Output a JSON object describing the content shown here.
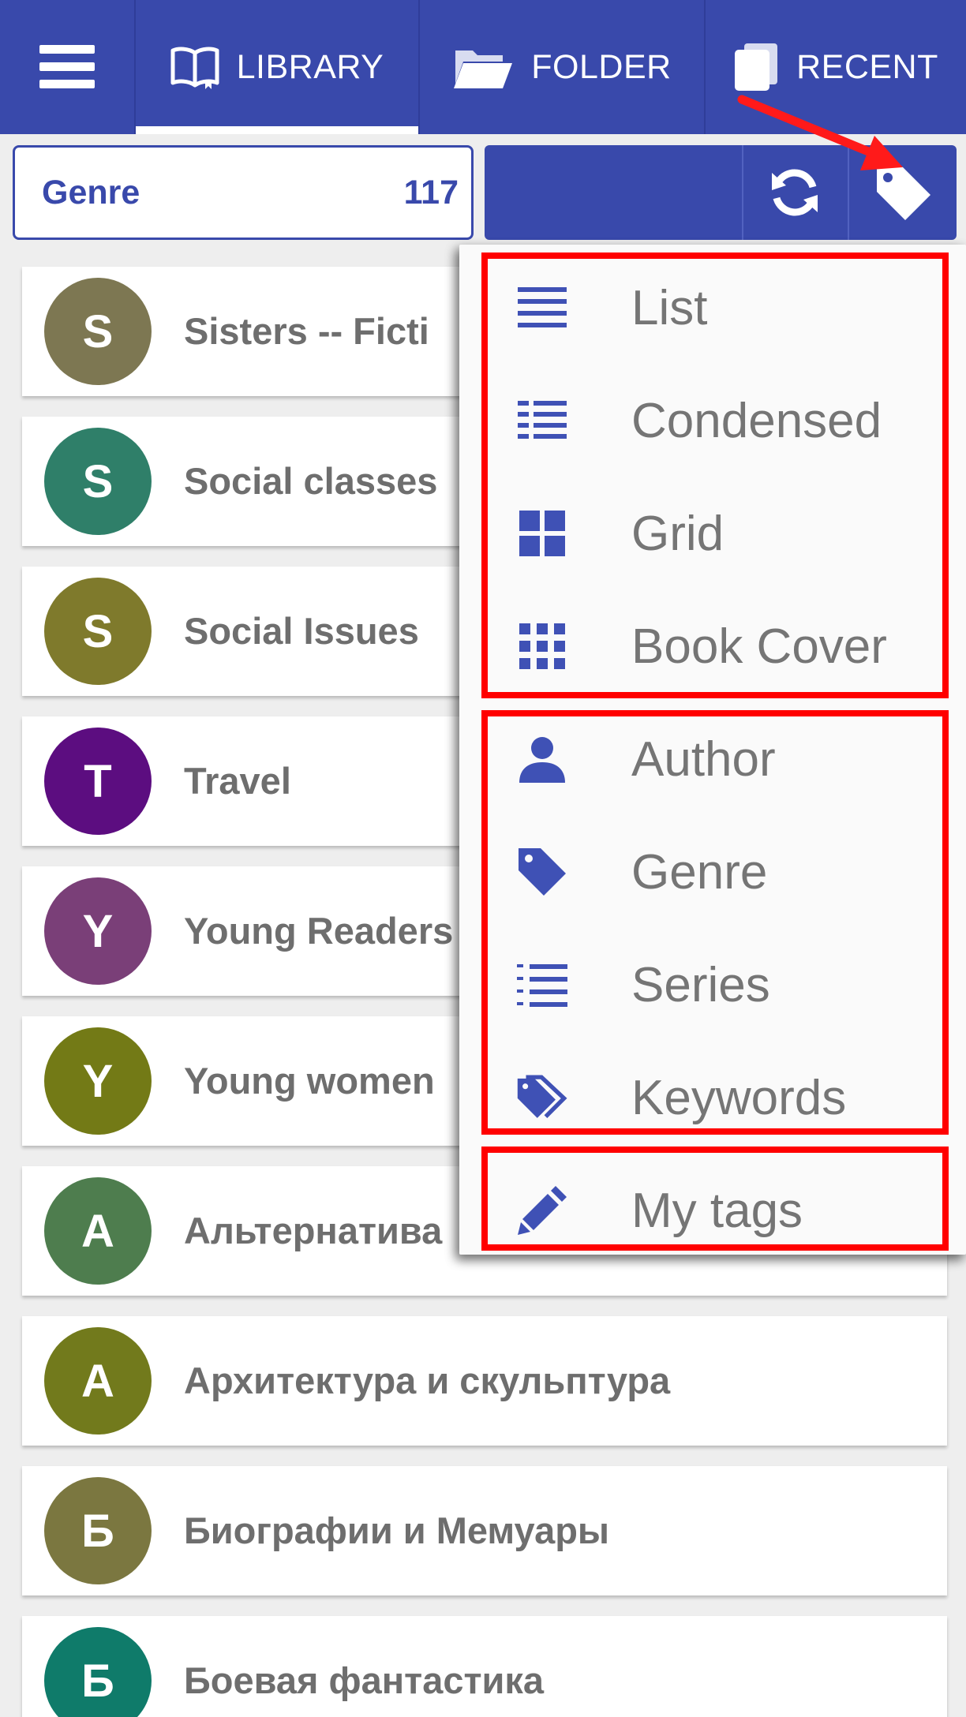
{
  "tabs": [
    {
      "label": "LIBRARY",
      "icon": "book-icon",
      "selected": true
    },
    {
      "label": "FOLDER",
      "icon": "folder-icon",
      "selected": false
    },
    {
      "label": "RECENT",
      "icon": "recent-books-icon",
      "selected": false
    }
  ],
  "filter": {
    "label": "Genre",
    "count": "117"
  },
  "list": [
    {
      "initial": "S",
      "label": "Sisters -- Ficti",
      "color": "#7d7752"
    },
    {
      "initial": "S",
      "label": "Social classes",
      "color": "#2f7f69"
    },
    {
      "initial": "S",
      "label": "Social Issues",
      "color": "#7f7a2c"
    },
    {
      "initial": "T",
      "label": "Travel",
      "color": "#5c0d80"
    },
    {
      "initial": "Y",
      "label": "Young Readers",
      "color": "#7a3f78"
    },
    {
      "initial": "Y",
      "label": "Young women",
      "color": "#737a16"
    },
    {
      "initial": "A",
      "label": "Альтернатива",
      "color": "#4e7d4e"
    },
    {
      "initial": "A",
      "label": "Архитектура и скульптура",
      "color": "#727a1c"
    },
    {
      "initial": "Б",
      "label": "Биографии и Мемуары",
      "color": "#7b7740"
    },
    {
      "initial": "Б",
      "label": "Боевая фантастика",
      "color": "#0f7b6a"
    }
  ],
  "menu": {
    "views": [
      {
        "label": "List",
        "icon": "list-icon"
      },
      {
        "label": "Condensed",
        "icon": "condensed-list-icon"
      },
      {
        "label": "Grid",
        "icon": "grid-icon"
      },
      {
        "label": "Book Cover",
        "icon": "book-cover-grid-icon"
      }
    ],
    "groups": [
      {
        "label": "Author",
        "icon": "person-icon"
      },
      {
        "label": "Genre",
        "icon": "tag-icon"
      },
      {
        "label": "Series",
        "icon": "numbered-list-icon"
      },
      {
        "label": "Keywords",
        "icon": "tags-icon"
      }
    ],
    "extra": [
      {
        "label": "My tags",
        "icon": "pencil-icon"
      }
    ]
  },
  "colors": {
    "primary": "#3949ab",
    "menu_icon": "#3f51b5",
    "highlight": "#ff0000",
    "text_muted": "#6e6e6e"
  }
}
